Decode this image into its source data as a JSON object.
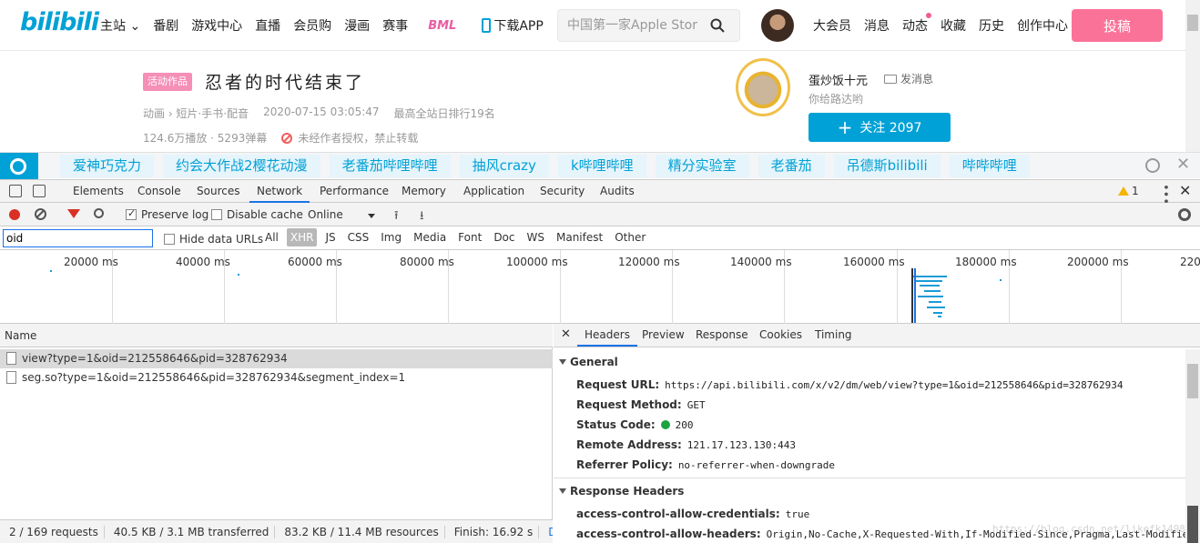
{
  "header": {
    "logo": "bilibili",
    "nav": [
      "主站",
      "番剧",
      "游戏中心",
      "直播",
      "会员购",
      "漫画",
      "赛事"
    ],
    "bml": "BML",
    "download": "下载APP",
    "search_placeholder": "中国第一家Apple Stor",
    "right_nav": [
      "大会员",
      "消息",
      "动态",
      "收藏",
      "历史",
      "创作中心"
    ],
    "upload": "投稿"
  },
  "video": {
    "tag": "活动作品",
    "title": "忍者的时代结束了",
    "category": "动画 › 短片·手书·配音",
    "date": "2020-07-15 03:05:47",
    "rank": "最高全站日排行19名",
    "plays": "124.6万播放 · 5293弹幕",
    "forbid": "未经作者授权，禁止转载",
    "up_name": "蛋炒饭十元",
    "msg": "发消息",
    "up_desc": "你给路达哟",
    "follow": "关注 2097"
  },
  "tagbar": [
    "爱神巧克力",
    "约会大作战2樱花动漫",
    "老番茄哔哩哔哩",
    "抽风crazy",
    "k哔哩哔哩",
    "精分实验室",
    "老番茄",
    "吊德斯bilibili",
    "哔哔哔哩"
  ],
  "devtools": {
    "tabs": [
      "Elements",
      "Console",
      "Sources",
      "Network",
      "Performance",
      "Memory",
      "Application",
      "Security",
      "Audits"
    ],
    "active_tab": "Network",
    "warnings": "1",
    "preserve_log": "Preserve log",
    "disable_cache": "Disable cache",
    "throttle": "Online",
    "filter_value": "oid",
    "hide_data_urls": "Hide data URLs",
    "types": [
      "All",
      "XHR",
      "JS",
      "CSS",
      "Img",
      "Media",
      "Font",
      "Doc",
      "WS",
      "Manifest",
      "Other"
    ],
    "active_type": "XHR",
    "ticks": [
      "20000 ms",
      "40000 ms",
      "60000 ms",
      "80000 ms",
      "100000 ms",
      "120000 ms",
      "140000 ms",
      "160000 ms",
      "180000 ms",
      "200000 ms",
      "220"
    ],
    "name_header": "Name",
    "requests": [
      "view?type=1&oid=212558646&pid=328762934",
      "seg.so?type=1&oid=212558646&pid=328762934&segment_index=1"
    ],
    "detail_tabs": [
      "Headers",
      "Preview",
      "Response",
      "Cookies",
      "Timing"
    ],
    "general_title": "General",
    "general": [
      {
        "k": "Request URL:",
        "v": "https://api.bilibili.com/x/v2/dm/web/view?type=1&oid=212558646&pid=328762934"
      },
      {
        "k": "Request Method:",
        "v": "GET"
      },
      {
        "k": "Status Code:",
        "v": "200"
      },
      {
        "k": "Remote Address:",
        "v": "121.17.123.130:443"
      },
      {
        "k": "Referrer Policy:",
        "v": "no-referrer-when-downgrade"
      }
    ],
    "response_title": "Response Headers",
    "response": [
      {
        "k": "access-control-allow-credentials:",
        "v": "true"
      },
      {
        "k": "access-control-allow-headers:",
        "v": "Origin,No-Cache,X-Requested-With,If-Modified-Since,Pragma,Last-Modified,Ca"
      }
    ],
    "status": {
      "requests": "2 / 169 requests",
      "transferred": "40.5 KB / 3.1 MB transferred",
      "resources": "83.2 KB / 11.4 MB resources",
      "finish": "Finish: 16.92 s",
      "dom": "DOMConten"
    },
    "watermark": "https://blog.csdn.net/likefk1498"
  }
}
